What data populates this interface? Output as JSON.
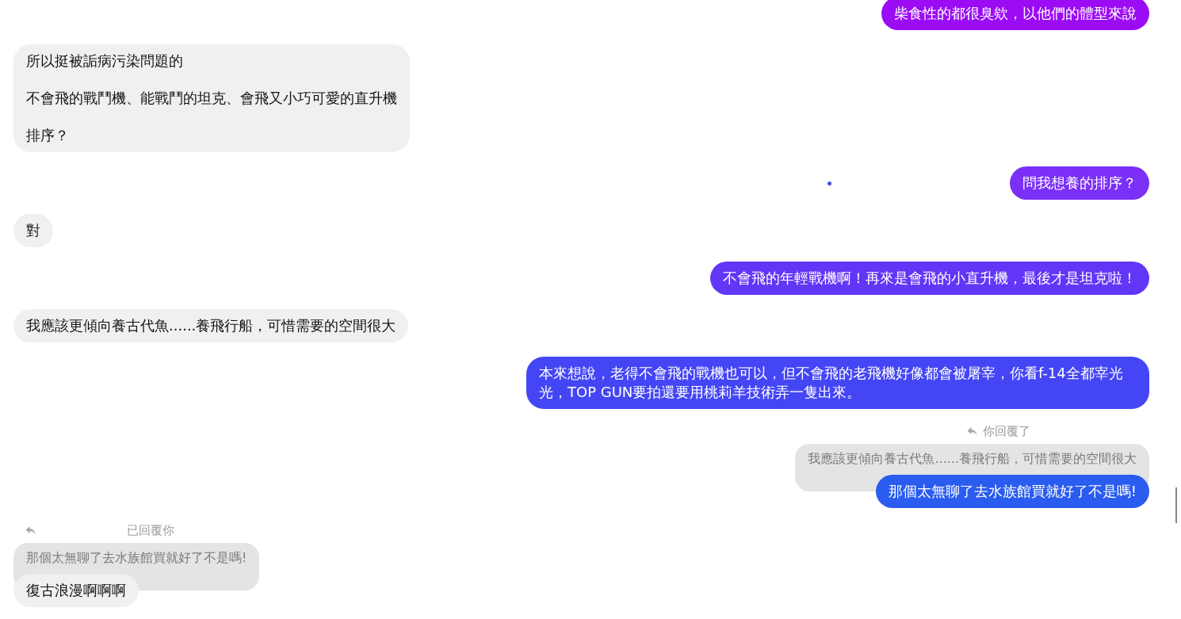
{
  "messages": [
    {
      "kind": "outgoing",
      "color": "#9b0cf5",
      "paragraphs": [
        "柴食性的都很臭欸，以他們的體型來說"
      ]
    },
    {
      "kind": "incoming",
      "paragraphs": [
        "所以挺被詬病污染問題的",
        "不會飛的戰鬥機、能戰鬥的坦克、會飛又小巧可愛的直升機",
        "排序？"
      ]
    },
    {
      "kind": "outgoing",
      "color": "#7b2ff7",
      "paragraphs": [
        "問我想養的排序？"
      ],
      "seen_dot": true
    },
    {
      "kind": "incoming",
      "paragraphs": [
        "對"
      ]
    },
    {
      "kind": "outgoing",
      "color": "#6236f7",
      "paragraphs": [
        "不會飛的年輕戰機啊！再來是會飛的小直升機，最後才是坦克啦！"
      ]
    },
    {
      "kind": "incoming",
      "paragraphs": [
        "我應該更傾向養古代魚......養飛行船，可惜需要的空間很大"
      ]
    },
    {
      "kind": "outgoing",
      "color": "#4446f5",
      "paragraphs": [
        "本來想說，老得不會飛的戰機也可以，但不會飛的老飛機好像都會被屠宰，你看f-14全都宰光光，TOP GUN要拍還要用桃莉羊技術弄一隻出來。"
      ]
    },
    {
      "kind": "outgoing_reply",
      "color": "#2a5cf0",
      "label": "你回覆了",
      "quoted": "我應該更傾向養古代魚......養飛行船，可惜需要的空間很大",
      "paragraphs": [
        "那個太無聊了去水族館買就好了不是嗎!"
      ]
    },
    {
      "kind": "incoming_reply",
      "label": "已回覆你",
      "quoted": "那個太無聊了去水族館買就好了不是嗎!",
      "paragraphs": [
        "復古浪漫啊啊啊"
      ]
    }
  ]
}
